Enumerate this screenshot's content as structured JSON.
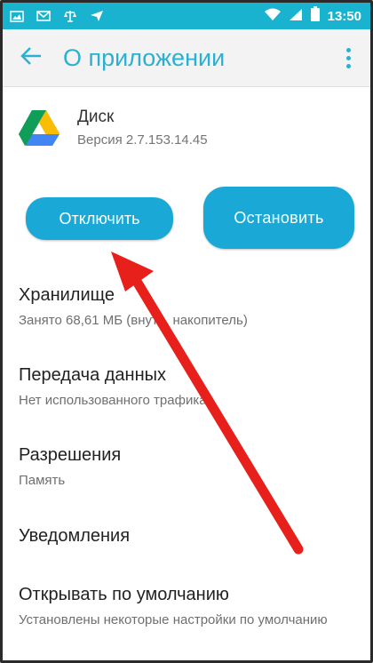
{
  "status_bar": {
    "time": "13:50",
    "left_icons": [
      "gallery-icon",
      "mail-icon",
      "scales-icon",
      "send-icon"
    ],
    "right_icons": [
      "wifi-icon",
      "signal-icon",
      "battery-icon"
    ]
  },
  "app_bar": {
    "title": "О приложении",
    "back_icon": "arrow-left-icon",
    "menu_icon": "more-vert-icon"
  },
  "app": {
    "name": "Диск",
    "version": "Версия 2.7.153.14.45",
    "icon": "google-drive-icon"
  },
  "buttons": {
    "disable": "Отключить",
    "stop": "Остановить"
  },
  "settings": {
    "storage": {
      "title": "Хранилище",
      "subtitle": "Занято 68,61 МБ (внутр. накопитель)"
    },
    "data": {
      "title": "Передача данных",
      "subtitle": "Нет использованного трафика"
    },
    "permissions": {
      "title": "Разрешения",
      "subtitle": "Память"
    },
    "notifications": {
      "title": "Уведомления"
    },
    "default": {
      "title": "Открывать по умолчанию",
      "subtitle": "Установлены некоторые настройки по умолчанию"
    }
  },
  "colors": {
    "status_bar": "#19b3cf",
    "accent": "#2cb0d2",
    "button": "#1aa9d6",
    "annotation_arrow": "#e8201c"
  }
}
